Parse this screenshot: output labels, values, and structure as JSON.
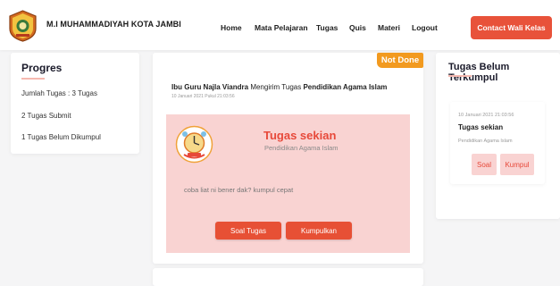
{
  "navbar": {
    "brand": "M.I MUHAMMADIYAH KOTA JAMBI",
    "links": [
      "Home",
      "Mata Pelajaran",
      "Tugas",
      "Quis",
      "Materi",
      "Logout"
    ],
    "contact_label": "Contact Wali Kelas",
    "accent_color": "#e8523a",
    "logo_icon": "school-emblem-icon"
  },
  "progress": {
    "title": "Progres",
    "items": [
      "Jumlah Tugas : 3 Tugas",
      "2 Tugas Submit",
      "1 Tugas Belum Dikumpul"
    ]
  },
  "task_card": {
    "status": "Not Done",
    "status_color": "#f29a1f",
    "sender_prefix": "Ibu Guru Najla Viandra",
    "sender_middle": " Mengirim Tugas ",
    "sender_subject": "Pendidikan Agama Islam",
    "datetime": "10 Januari 2021 Pukul 21:03:56",
    "title": "Tugas sekian",
    "subject": "Pendidikan Agama Islam",
    "description": "coba liat ni bener dak? kumpul cepat",
    "soal_button": "Soal Tugas",
    "submit_button": "Kumpulkan",
    "logo_icon": "clock-illustration-icon"
  },
  "pending": {
    "title": "Tugas Belum Terkumpul",
    "item": {
      "datetime": "10 Januari 2021   21:03:56",
      "title": "Tugas sekian",
      "subject": "Pendidikan Agama Islam",
      "soal_button": "Soal",
      "submit_button": "Kumpul"
    }
  }
}
